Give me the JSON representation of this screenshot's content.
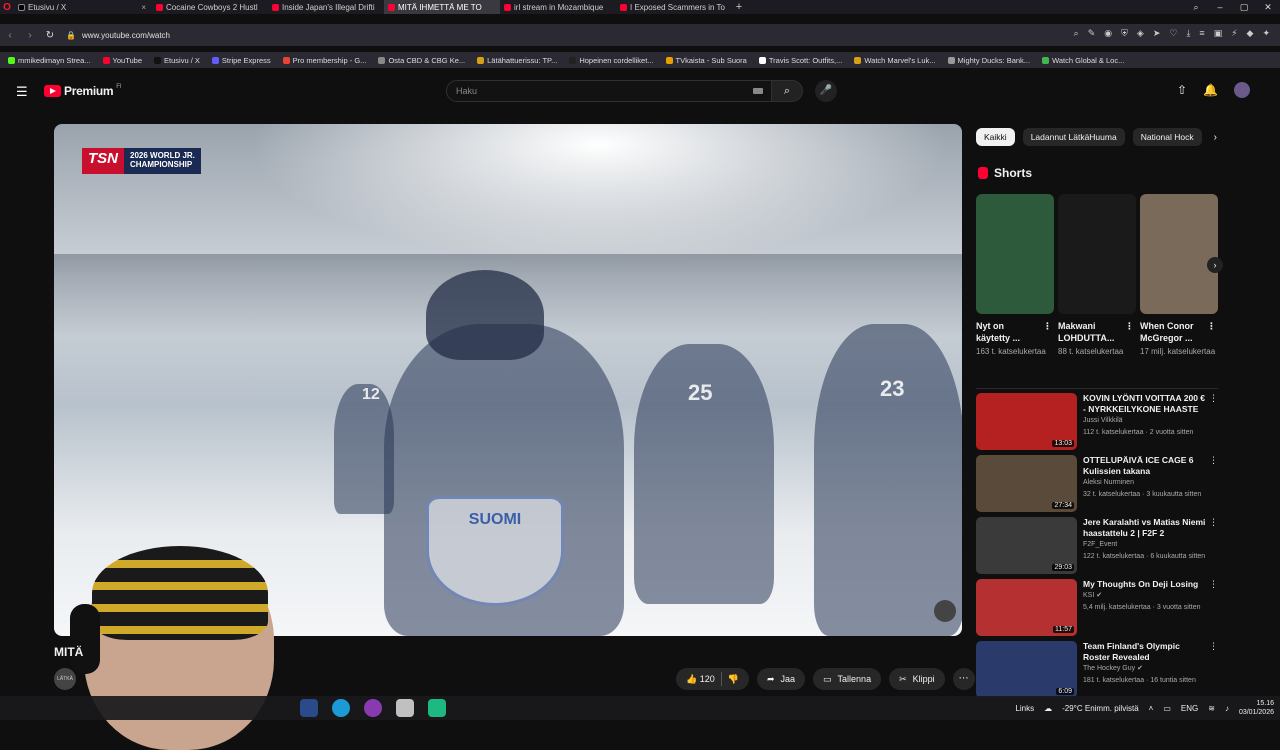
{
  "browser": {
    "tabs": [
      {
        "title": "Etusivu / X",
        "fav": "x"
      },
      {
        "title": "Cocaine Cowboys 2 Hustl",
        "fav": "yt"
      },
      {
        "title": "Inside Japan's Illegal Drifti",
        "fav": "yt"
      },
      {
        "title": "MITÄ IHMETTÄ ME TO",
        "fav": "yt",
        "active": true
      },
      {
        "title": "irl stream in Mozambique",
        "fav": "yt"
      },
      {
        "title": "I Exposed Scammers in To",
        "fav": "yt"
      }
    ],
    "url": "www.youtube.com/watch",
    "bookmarks": [
      {
        "label": "mmikedimayn Strea...",
        "color": "#53fc18"
      },
      {
        "label": "YouTube",
        "color": "#ff0033"
      },
      {
        "label": "Etusivu / X",
        "color": "#111111"
      },
      {
        "label": "Stripe Express",
        "color": "#635bff"
      },
      {
        "label": "Pro membership - G...",
        "color": "#ea4335"
      },
      {
        "label": "Osta CBD & CBG Ke...",
        "color": "#888888"
      },
      {
        "label": "Lätähattuerissu: TP...",
        "color": "#d4a017"
      },
      {
        "label": "Hopeinen cordelliket...",
        "color": "#222222"
      },
      {
        "label": "TVkaista - Sub Suora",
        "color": "#e6a100"
      },
      {
        "label": "Travis Scott: Outfits,...",
        "color": "#ffffff"
      },
      {
        "label": "Watch Marvel's Luk...",
        "color": "#d4a017"
      },
      {
        "label": "Mighty Ducks: Bank...",
        "color": "#999999"
      },
      {
        "label": "Watch Global & Loc...",
        "color": "#3fb950"
      }
    ]
  },
  "header": {
    "brand": "Premium",
    "region": "FI",
    "search_placeholder": "Haku"
  },
  "video": {
    "broadcaster": "TSN",
    "event_line1": "2026 WORLD JR.",
    "event_line2": "CHAMPIONSHIP",
    "crest_text": "SUOMI",
    "title_fragment": "MITÄ",
    "channel_avatar_text": "LÄTKÄ",
    "likes": "120",
    "share_label": "Jaa",
    "save_label": "Tallenna",
    "clip_label": "Klippi"
  },
  "chips": [
    "Kaikki",
    "Ladannut LätkäHuuma",
    "National Hock"
  ],
  "shorts": {
    "heading": "Shorts",
    "items": [
      {
        "title": "Nyt on käytetty ...",
        "views": "163 t. katselukertaa",
        "bg": "#2d5a3a"
      },
      {
        "title": "Makwani LOHDUTTA...",
        "views": "88 t. katselukertaa",
        "bg": "#1a1a1a"
      },
      {
        "title": "When Conor McGregor ...",
        "views": "17 milj. katselukertaa",
        "bg": "#7a6a5a"
      }
    ]
  },
  "recommended": [
    {
      "title": "KOVIN LYÖNTI VOITTAA 200 € - NYRKKEILYKONE HAASTE",
      "channel": "Jussi Vilkkilä",
      "stats": "112 t. katselukertaa · 2 vuotta sitten",
      "duration": "13:03",
      "bg": "#b52020"
    },
    {
      "title": "OTTELUPÄIVÄ ICE CAGE 6 Kulissien takana",
      "channel": "Aleksi Nurminen",
      "stats": "32 t. katselukertaa · 3 kuukautta sitten",
      "duration": "27:34",
      "bg": "#5a4a3a"
    },
    {
      "title": "Jere Karalahti vs Matias Niemi haastattelu 2 | F2F 2",
      "channel": "F2F_Event",
      "stats": "122 t. katselukertaa · 6 kuukautta sitten",
      "duration": "29:03",
      "bg": "#3a3a3a"
    },
    {
      "title": "My Thoughts On Deji Losing",
      "channel": "KSI ✔",
      "stats": "5,4 milj. katselukertaa · 3 vuotta sitten",
      "duration": "11:57",
      "bg": "#b53030"
    },
    {
      "title": "Team Finland's Olympic Roster Revealed",
      "channel": "The Hockey Guy ✔",
      "stats": "181 t. katselukertaa · 16 tuntia sitten",
      "duration": "6:09",
      "bg": "#2a3a6a"
    }
  ],
  "taskbar": {
    "links": "Links",
    "weather": "-29°C  Enimm. pilvistä",
    "lang": "ENG",
    "time": "15.16",
    "date": "03/01/2026"
  }
}
